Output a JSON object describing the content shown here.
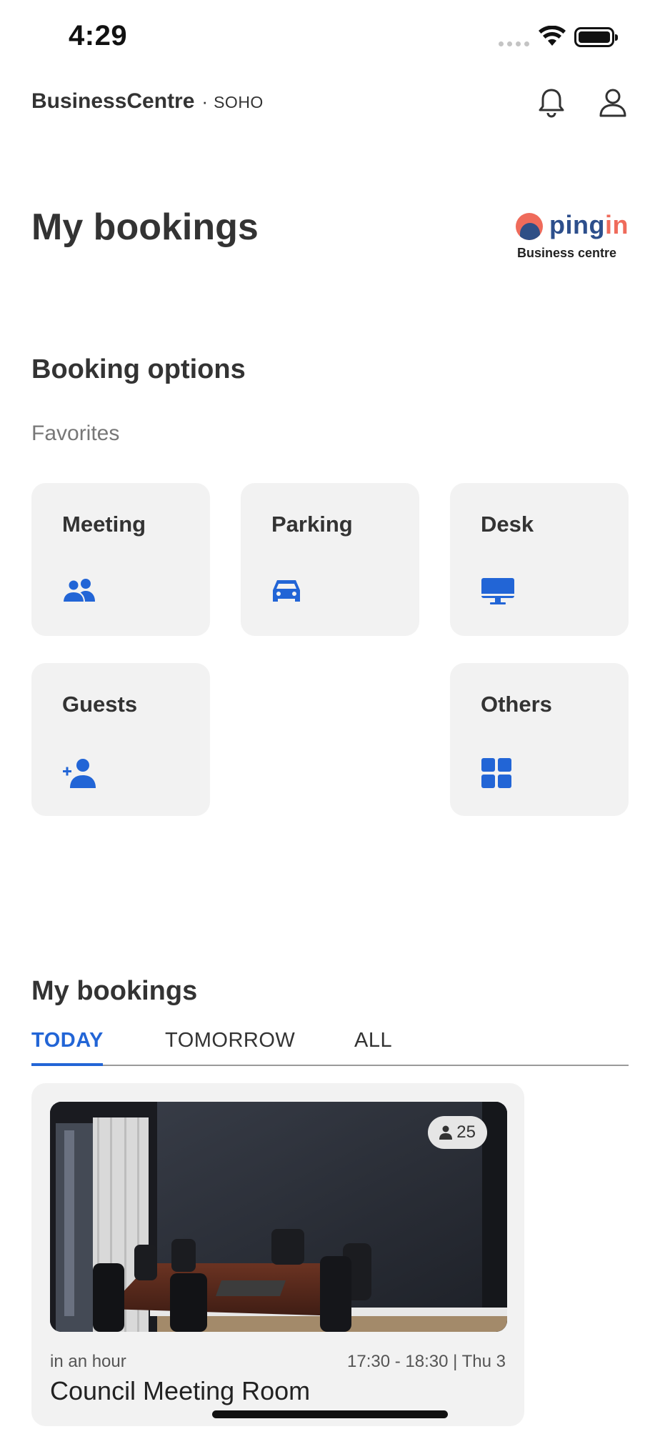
{
  "status_bar": {
    "time": "4:29"
  },
  "header": {
    "brand": "BusinessCentre",
    "separator": "·",
    "location": "SOHO"
  },
  "page_title": "My bookings",
  "logo": {
    "word_main": "ping",
    "word_accent": "in",
    "subtitle": "Business centre"
  },
  "booking_options": {
    "title": "Booking options",
    "favorites_label": "Favorites",
    "tiles": [
      {
        "label": "Meeting",
        "icon": "people-icon"
      },
      {
        "label": "Parking",
        "icon": "car-icon"
      },
      {
        "label": "Desk",
        "icon": "desktop-icon"
      },
      {
        "label": "Guests",
        "icon": "add-person-icon"
      },
      {
        "label": "Others",
        "icon": "grid-icon"
      }
    ]
  },
  "my_bookings": {
    "title": "My bookings",
    "tabs": [
      {
        "label": "TODAY",
        "active": true
      },
      {
        "label": "TOMORROW",
        "active": false
      },
      {
        "label": "ALL",
        "active": false
      }
    ],
    "cards": [
      {
        "when": "in an hour",
        "time": "17:30 - 18:30 | Thu 3",
        "title": "Council Meeting Room",
        "capacity": "25"
      }
    ]
  },
  "colors": {
    "accent": "#2265d6",
    "tile_bg": "#f2f2f2",
    "text": "#333333"
  }
}
